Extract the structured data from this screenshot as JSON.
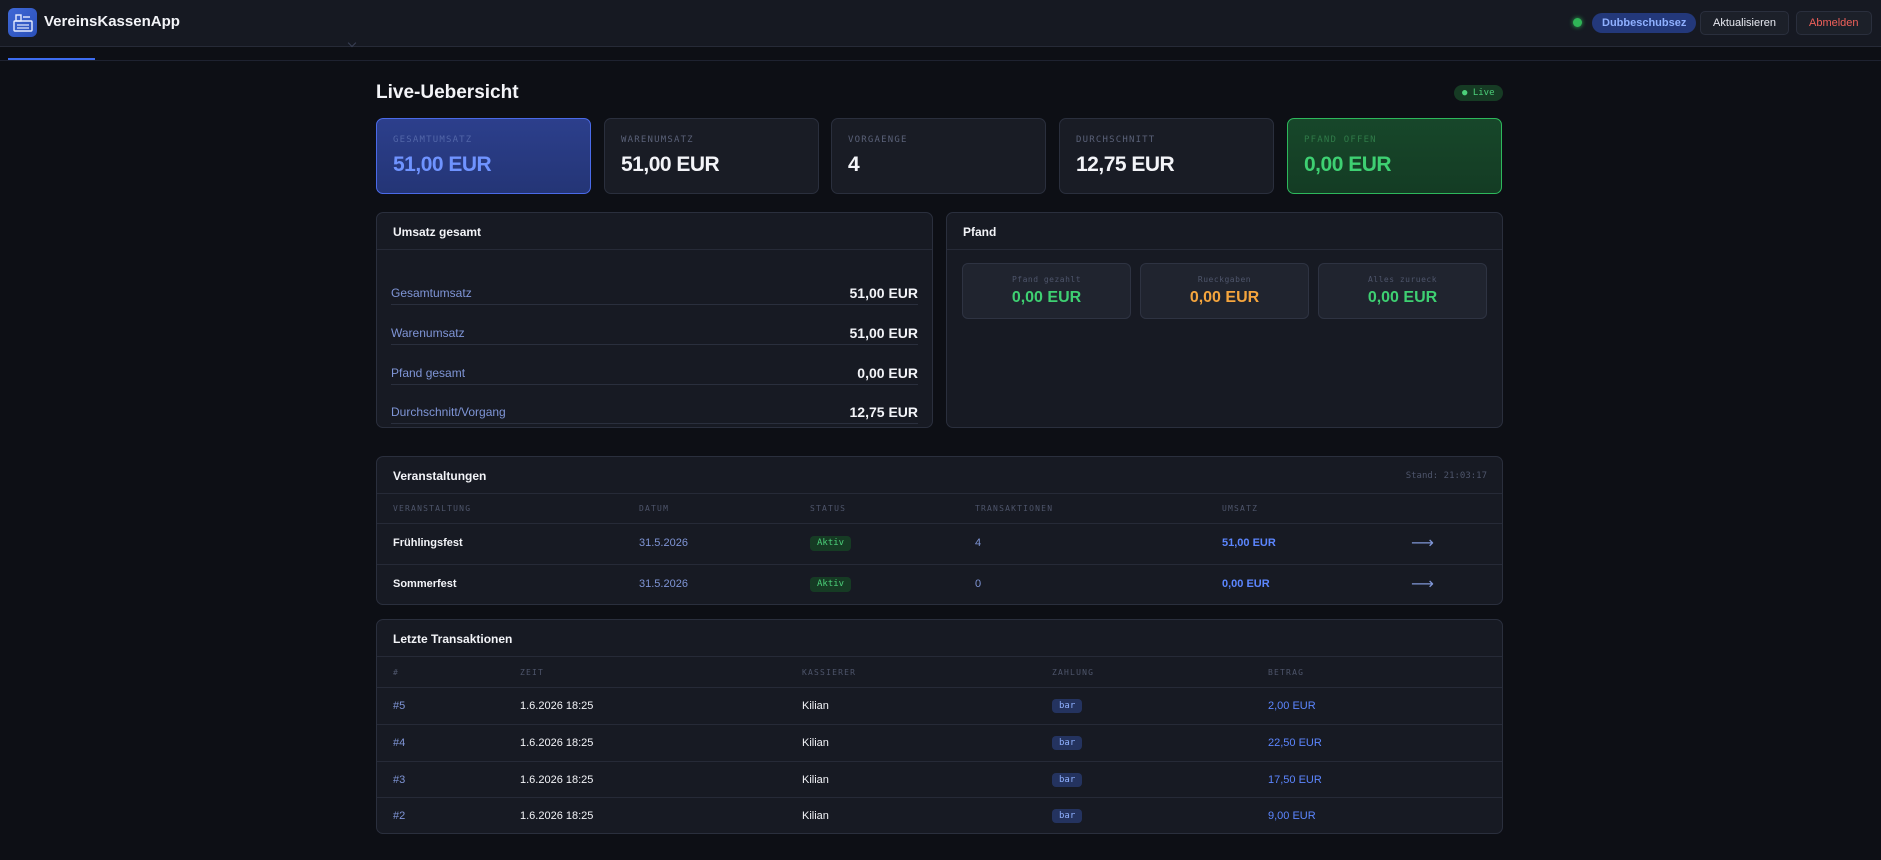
{
  "app": {
    "title": "VereinsKassenApp",
    "user": "Dubbeschubsez",
    "refresh_label": "Aktualisieren",
    "logout_label": "Abmelden",
    "accent_color": "#3d6cf0"
  },
  "overview": {
    "title": "Live-Uebersicht",
    "live_badge": "● Live"
  },
  "kpis": [
    {
      "label": "Gesamtumsatz",
      "value": "51,00 EUR"
    },
    {
      "label": "Warenumsatz",
      "value": "51,00 EUR"
    },
    {
      "label": "Vorgaenge",
      "value": "4"
    },
    {
      "label": "Durchschnitt",
      "value": "12,75 EUR"
    },
    {
      "label": "Pfand offen",
      "value": "0,00 EUR"
    }
  ],
  "umsatz": {
    "title": "Umsatz gesamt",
    "rows": [
      {
        "label": "Gesamtumsatz",
        "value": "51,00 EUR"
      },
      {
        "label": "Warenumsatz",
        "value": "51,00 EUR"
      },
      {
        "label": "Pfand gesamt",
        "value": "0,00 EUR"
      },
      {
        "label": "Durchschnitt/Vorgang",
        "value": "12,75 EUR"
      }
    ]
  },
  "pfand": {
    "title": "Pfand",
    "boxes": [
      {
        "label": "Pfand gezahlt",
        "value": "0,00 EUR"
      },
      {
        "label": "Rueckgaben",
        "value": "0,00 EUR"
      },
      {
        "label": "Alles zurueck",
        "value": "0,00 EUR"
      }
    ]
  },
  "events": {
    "title": "Veranstaltungen",
    "stand": "Stand: 21:03:17",
    "columns": [
      "Veranstaltung",
      "Datum",
      "Status",
      "Transaktionen",
      "Umsatz"
    ],
    "rows": [
      {
        "name": "Frühlingsfest",
        "date": "31.5.2026",
        "status": "Aktiv",
        "transactions": "4",
        "revenue": "51,00 EUR",
        "arrow": "⟶"
      },
      {
        "name": "Sommerfest",
        "date": "31.5.2026",
        "status": "Aktiv",
        "transactions": "0",
        "revenue": "0,00 EUR",
        "arrow": "⟶"
      }
    ]
  },
  "transactions": {
    "title": "Letzte Transaktionen",
    "columns": [
      "#",
      "Zeit",
      "Kassierer",
      "Zahlung",
      "Betrag"
    ],
    "rows": [
      {
        "id": "#5",
        "time": "1.6.2026 18:25",
        "cashier": "Kilian",
        "payment": "bar",
        "amount": "2,00 EUR"
      },
      {
        "id": "#4",
        "time": "1.6.2026 18:25",
        "cashier": "Kilian",
        "payment": "bar",
        "amount": "22,50 EUR"
      },
      {
        "id": "#3",
        "time": "1.6.2026 18:25",
        "cashier": "Kilian",
        "payment": "bar",
        "amount": "17,50 EUR"
      },
      {
        "id": "#2",
        "time": "1.6.2026 18:25",
        "cashier": "Kilian",
        "payment": "bar",
        "amount": "9,00 EUR"
      }
    ]
  }
}
